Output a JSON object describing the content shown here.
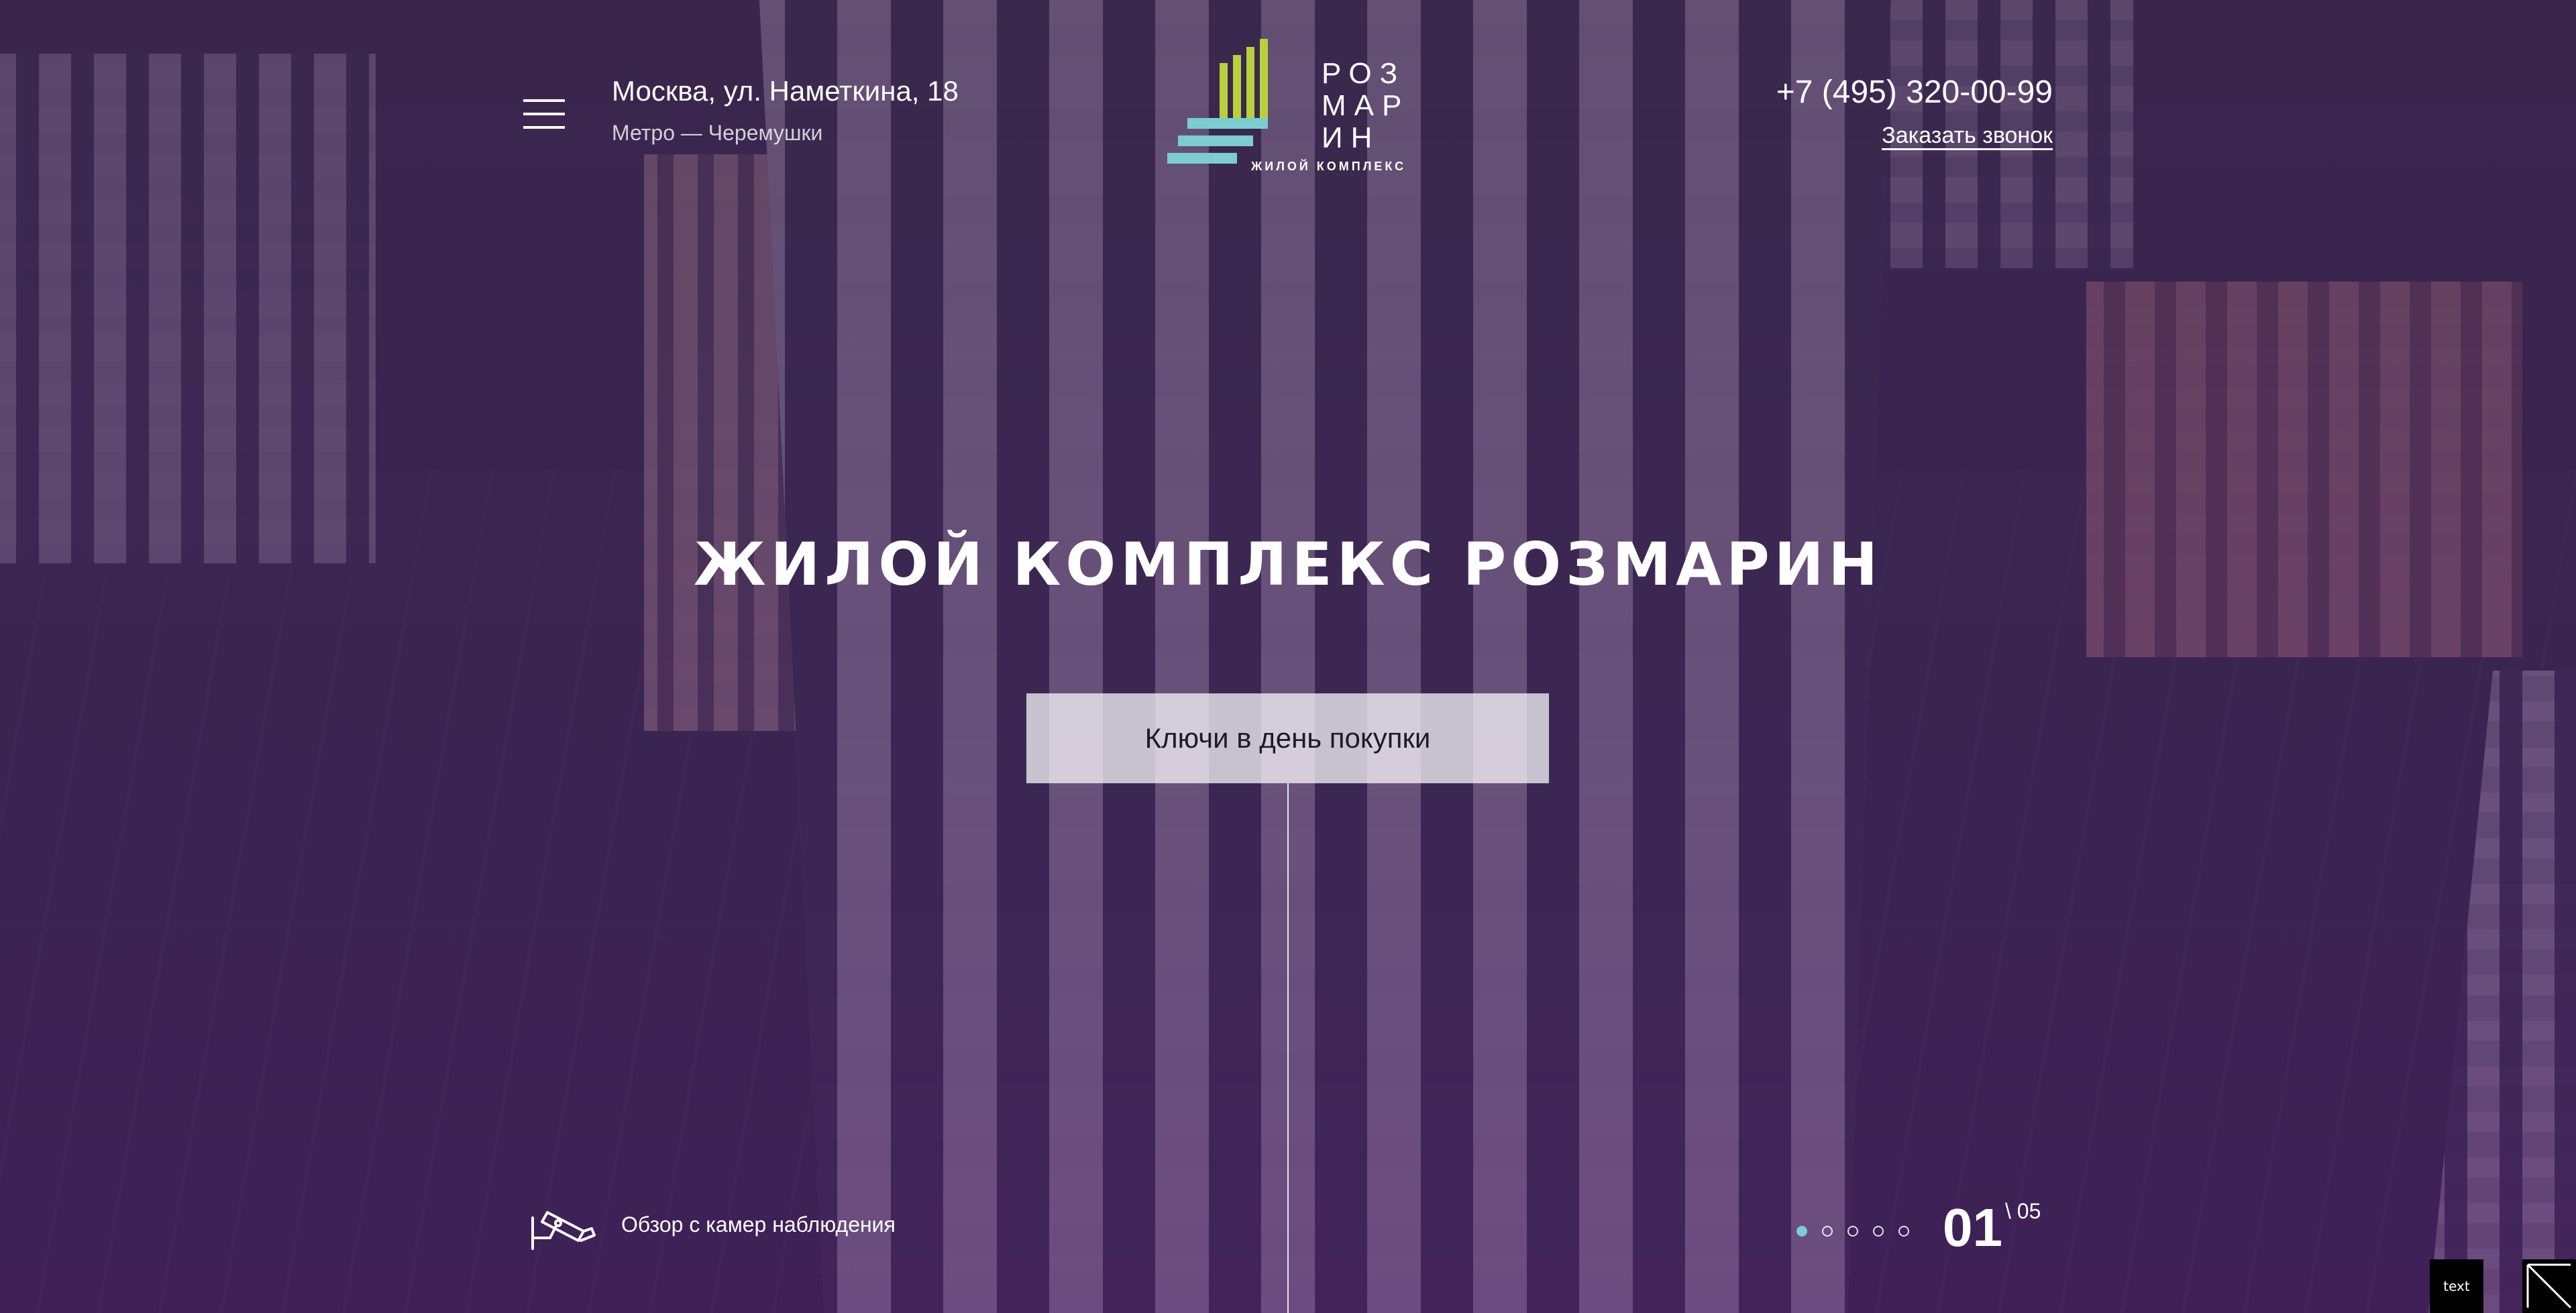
{
  "header": {
    "address": "Москва, ул. Наметкина, 18",
    "metro": "Метро — Черемушки",
    "phone": "+7 (495) 320-00-99",
    "callback_label": "Заказать звонок",
    "menu_icon": "hamburger-menu-icon"
  },
  "logo": {
    "line1": "РОЗ",
    "line2": "МАР",
    "line3": "ИН",
    "subtitle": "ЖИЛОЙ КОМПЛЕКС",
    "colors": {
      "green": "#b7d13a",
      "teal": "#7ccdd0"
    }
  },
  "hero": {
    "title": "ЖИЛОЙ КОМПЛЕКС РОЗМАРИН",
    "cta_label": "Ключи в день покупки"
  },
  "footer": {
    "camera_link_label": "Обзор с камер наблюдения",
    "camera_icon": "security-camera-icon",
    "slider": {
      "current": "01",
      "total": "\\ 05",
      "dots_count": 5,
      "active_index": 0
    },
    "corner_widget_label": "text"
  },
  "colors": {
    "accent_teal": "#7ccdd0",
    "accent_green": "#b7d13a",
    "overlay_purple": "#3e215c"
  }
}
